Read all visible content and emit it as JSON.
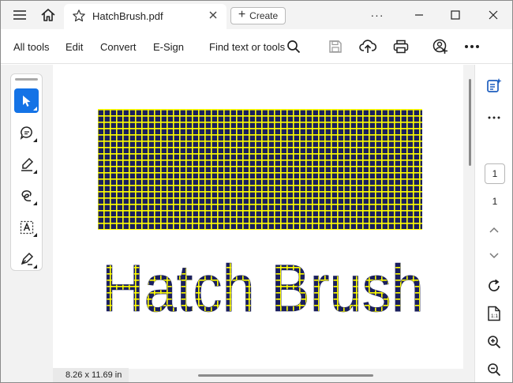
{
  "titlebar": {
    "tab_title": "HatchBrush.pdf",
    "create_label": "Create",
    "more_label": "···"
  },
  "toolbar": {
    "menu": [
      "All tools",
      "Edit",
      "Convert",
      "E-Sign"
    ],
    "find_label": "Find text or tools"
  },
  "document": {
    "heading_text": "Hatch Brush",
    "hatch_foreground": "#ffff00",
    "hatch_background": "#1a1f5e",
    "page_size_label": "8.26 x 11.69 in"
  },
  "rail": {
    "current_page": "1",
    "total_pages": "1"
  },
  "colors": {
    "accent": "#1473e6",
    "rail_icon": "#1f5fbf"
  }
}
